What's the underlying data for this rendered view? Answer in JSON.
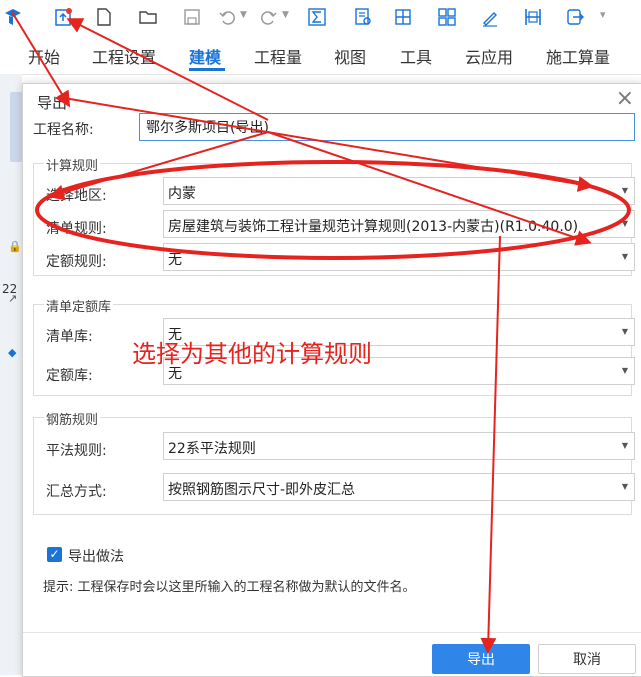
{
  "toolbar": {
    "icons": [
      "app-logo-icon",
      "upload-file-icon",
      "new-file-icon",
      "open-folder-icon",
      "save-icon",
      "undo-icon",
      "redo-icon",
      "sum-icon",
      "doc-search-icon",
      "grid-table-icon",
      "grid-arrange-icon",
      "pen-icon",
      "ruler-icon",
      "export-icon",
      "more-icon"
    ]
  },
  "tabs": [
    "开始",
    "工程设置",
    "建模",
    "工程量",
    "视图",
    "工具",
    "云应用",
    "施工算量"
  ],
  "left_strip": {
    "number": "22"
  },
  "dialog": {
    "title": "导出",
    "close": "×",
    "project_name_label": "工程名称:",
    "project_name_value": "鄂尔多斯项目(导出)",
    "calc_rules": {
      "title": "计算规则",
      "region_label": "选择地区:",
      "region_value": "内蒙",
      "list_rule_label": "清单规则:",
      "list_rule_value": "房屋建筑与装饰工程计量规范计算规则(2013-内蒙古)(R1.0.40.0)",
      "quota_rule_label": "定额规则:",
      "quota_rule_value": "无"
    },
    "library": {
      "title": "清单定额库",
      "list_lib_label": "清单库:",
      "list_lib_value": "无",
      "quota_lib_label": "定额库:",
      "quota_lib_value": "无"
    },
    "rebar": {
      "title": "钢筋规则",
      "flat_rule_label": "平法规则:",
      "flat_rule_value": "22系平法规则",
      "summary_label": "汇总方式:",
      "summary_value": "按照钢筋图示尺寸-即外皮汇总"
    },
    "export_method_label": "导出做法",
    "export_method_checked": true,
    "hint": "提示: 工程保存时会以这里所输入的工程名称做为默认的文件名。",
    "export_button": "导出",
    "cancel_button": "取消"
  },
  "annotation": {
    "text": "选择为其他的计算规则",
    "color": "#e5231f"
  },
  "colors": {
    "accent": "#1a73d6",
    "primary_button": "#2f86e8"
  }
}
